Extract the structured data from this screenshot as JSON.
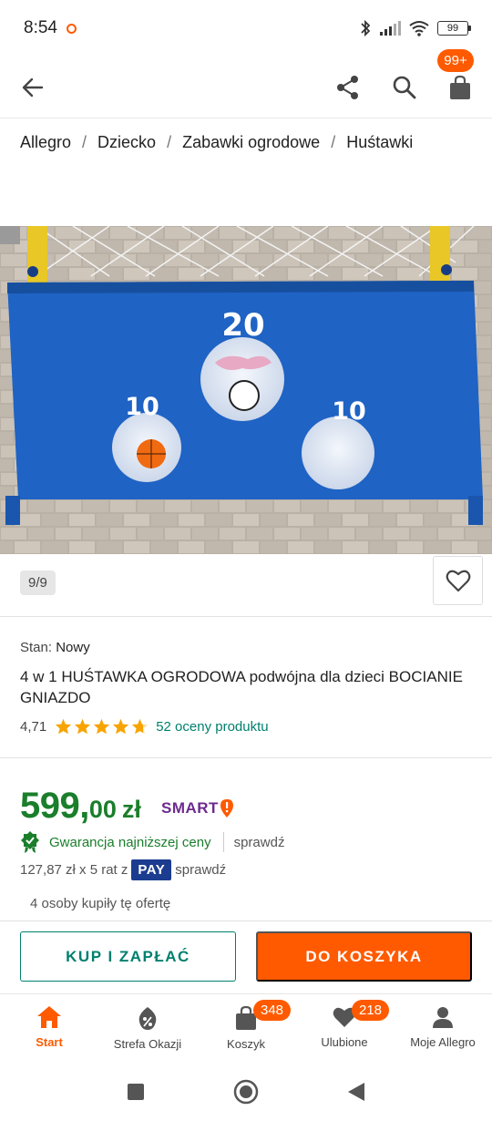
{
  "status_bar": {
    "time": "8:54",
    "battery": "99"
  },
  "app_bar": {
    "cart_badge": "99+"
  },
  "breadcrumb": [
    "Allegro",
    "Dziecko",
    "Zabawki ogrodowe",
    "Huśtawki"
  ],
  "gallery": {
    "counter": "9/9",
    "image_labels": {
      "top": "20",
      "left": "10",
      "right": "10"
    }
  },
  "product": {
    "condition_label": "Stan:",
    "condition_value": "Nowy",
    "title": "4 w 1 HUŚTAWKA OGRODOWA podwójna dla dzieci BOCIANIE GNIAZDO",
    "rating_value": "4,71",
    "rating_stars": 4.71,
    "rating_count": "52 oceny produktu"
  },
  "pricing": {
    "price_int": "599,",
    "price_dec": "00",
    "currency": "zł",
    "smart_label": "SMART",
    "guarantee_text": "Gwarancja najniższej ceny",
    "guarantee_check": "sprawdź",
    "installments_text": "127,87 zł x 5 rat z",
    "pay_badge": "PAY",
    "installments_check": "sprawdź",
    "buyers_text": "4 osoby kupiły tę ofertę"
  },
  "actions": {
    "buy_now": "KUP I ZAPŁAĆ",
    "add_to_cart": "DO KOSZYKA"
  },
  "bottom_nav": {
    "items": [
      {
        "label": "Start",
        "icon": "home-icon",
        "active": true
      },
      {
        "label": "Strefa Okazji",
        "icon": "discount-tag-icon"
      },
      {
        "label": "Koszyk",
        "icon": "shopping-bag-icon",
        "badge": "348"
      },
      {
        "label": "Ulubione",
        "icon": "heart-icon",
        "badge": "218"
      },
      {
        "label": "Moje Allegro",
        "icon": "user-icon"
      }
    ]
  },
  "colors": {
    "accent": "#ff5a00",
    "teal": "#00806e",
    "price_green": "#1a7e2b",
    "smart_purple": "#6d2b8e",
    "pay_blue": "#1b3c8f"
  }
}
